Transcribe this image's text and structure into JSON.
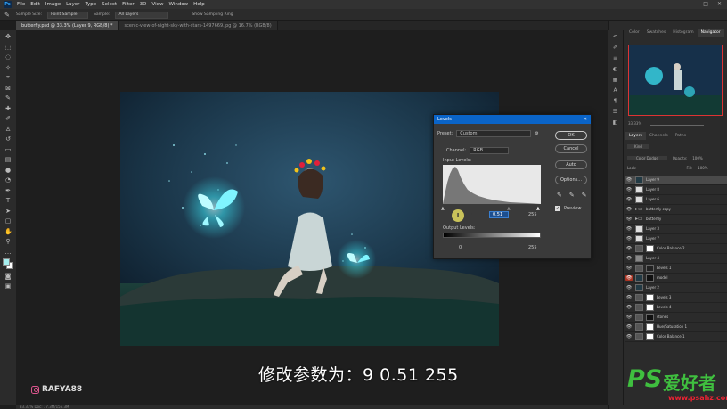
{
  "menubar": {
    "logo": "Ps",
    "items": [
      "File",
      "Edit",
      "Image",
      "Layer",
      "Type",
      "Select",
      "Filter",
      "3D",
      "View",
      "Window",
      "Help"
    ]
  },
  "options": {
    "sample_size_label": "Sample Size:",
    "sample_size_value": "Point Sample",
    "sample_label": "Sample:",
    "sample_value": "All Layers",
    "show_ring": "Show Sampling Ring"
  },
  "tabs": [
    {
      "label": "butterfly.psd @ 33.3% (Layer 9, RGB/8) *"
    },
    {
      "label": "scenic-view-of-night-sky-with-stars-1497669.jpg @ 16.7% (RGB/8)"
    }
  ],
  "status": {
    "text": "33.33%      Doc: 17.3M/155.3M"
  },
  "levels": {
    "title": "Levels",
    "preset_label": "Preset:",
    "preset_value": "Custom",
    "channel_label": "Channel:",
    "channel_value": "RGB",
    "input_levels_label": "Input Levels:",
    "input_black": "0",
    "input_gamma": "0.51",
    "input_white": "255",
    "output_levels_label": "Output Levels:",
    "output_black": "0",
    "output_white": "255",
    "ok": "OK",
    "cancel": "Cancel",
    "auto": "Auto",
    "options": "Options...",
    "preview": "Preview"
  },
  "right_panel": {
    "top_tabs": [
      "Color",
      "Swatches",
      "Histogram",
      "Navigator"
    ],
    "zoom": "33.33%",
    "layer_tabs": [
      "Layers",
      "Channels",
      "Paths"
    ],
    "kind": "Kind",
    "blend_mode": "Color Dodge",
    "opacity_label": "Opacity:",
    "opacity_value": "100%",
    "lock_label": "Lock:",
    "fill_label": "Fill:",
    "fill_value": "100%",
    "layers": [
      {
        "name": "Layer 9",
        "type": "pixel",
        "selected": true
      },
      {
        "name": "Layer 8",
        "type": "pixel"
      },
      {
        "name": "Layer 6",
        "type": "pixel"
      },
      {
        "name": "butterfly copy",
        "type": "folder"
      },
      {
        "name": "butterfly",
        "type": "folder"
      },
      {
        "name": "Layer 3",
        "type": "pixel"
      },
      {
        "name": "Layer 7",
        "type": "pixel"
      },
      {
        "name": "Color Balance 2",
        "type": "adjust"
      },
      {
        "name": "Layer 4",
        "type": "pixel"
      },
      {
        "name": "Levels 1",
        "type": "adjust"
      },
      {
        "name": "model",
        "type": "photo",
        "red_eye": true
      },
      {
        "name": "Layer 2",
        "type": "pixel"
      },
      {
        "name": "Levels 3",
        "type": "adjust"
      },
      {
        "name": "Levels 4",
        "type": "adjust"
      },
      {
        "name": "stones",
        "type": "adjust"
      },
      {
        "name": "Hue/Saturation 1",
        "type": "adjust"
      },
      {
        "name": "Color Balance 1",
        "type": "adjust"
      }
    ]
  },
  "overlay": {
    "subtitle": "修改参数为：9 0.51 255",
    "instagram": "RAFYA88",
    "site_big": "PS",
    "site_cn": "爱好者",
    "site_url": "www.psahz.com"
  },
  "colors": {
    "dialog_title": "#0a64c8",
    "glow": "#3ef0ff",
    "watermark_green": "#3fbf3f",
    "watermark_red": "#e23"
  }
}
